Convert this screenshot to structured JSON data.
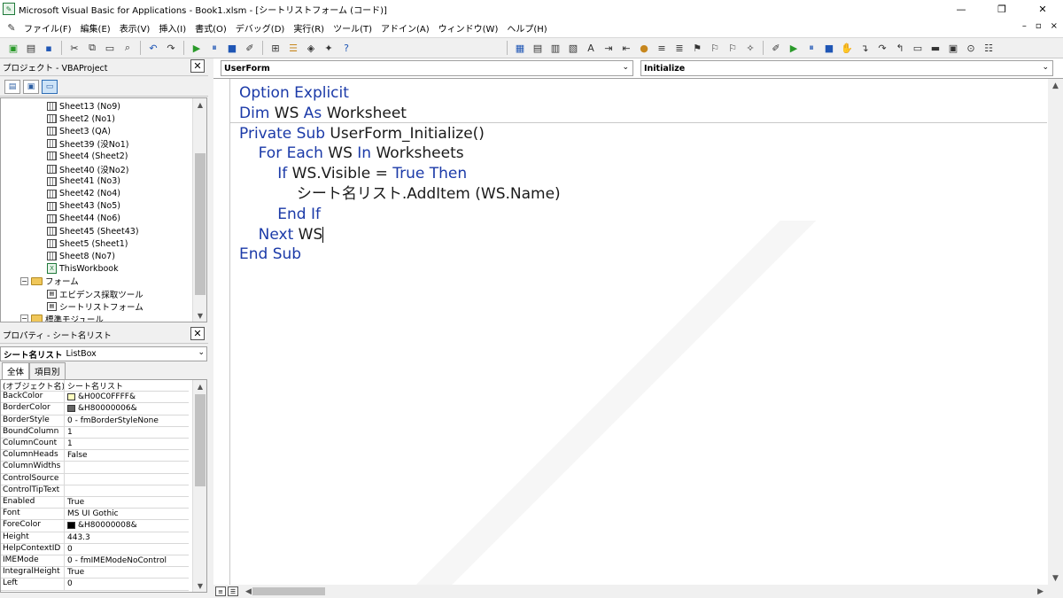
{
  "window": {
    "title": "Microsoft Visual Basic for Applications - Book1.xlsm - [シートリストフォーム (コード)]",
    "controls": {
      "minimize": "—",
      "restore": "❐",
      "close": "✕"
    }
  },
  "menu": {
    "items": [
      "ファイル(F)",
      "編集(E)",
      "表示(V)",
      "挿入(I)",
      "書式(O)",
      "デバッグ(D)",
      "実行(R)",
      "ツール(T)",
      "アドイン(A)",
      "ウィンドウ(W)",
      "ヘルプ(H)"
    ],
    "child_controls": [
      "–",
      "▫",
      "×"
    ]
  },
  "project_pane": {
    "title": "プロジェクト - VBAProject",
    "tree": [
      {
        "label": "Sheet13 (No9)",
        "kind": "sheet"
      },
      {
        "label": "Sheet2 (No1)",
        "kind": "sheet"
      },
      {
        "label": "Sheet3 (QA)",
        "kind": "sheet"
      },
      {
        "label": "Sheet39 (没No1)",
        "kind": "sheet"
      },
      {
        "label": "Sheet4 (Sheet2)",
        "kind": "sheet"
      },
      {
        "label": "Sheet40 (没No2)",
        "kind": "sheet"
      },
      {
        "label": "Sheet41 (No3)",
        "kind": "sheet"
      },
      {
        "label": "Sheet42 (No4)",
        "kind": "sheet"
      },
      {
        "label": "Sheet43 (No5)",
        "kind": "sheet"
      },
      {
        "label": "Sheet44 (No6)",
        "kind": "sheet"
      },
      {
        "label": "Sheet45 (Sheet43)",
        "kind": "sheet"
      },
      {
        "label": "Sheet5 (Sheet1)",
        "kind": "sheet"
      },
      {
        "label": "Sheet8 (No7)",
        "kind": "sheet"
      },
      {
        "label": "ThisWorkbook",
        "kind": "workbook"
      },
      {
        "label": "フォーム",
        "kind": "folder"
      },
      {
        "label": "エビデンス採取ツール",
        "kind": "form"
      },
      {
        "label": "シートリストフォーム",
        "kind": "form"
      },
      {
        "label": "標準モジュール",
        "kind": "folder"
      }
    ]
  },
  "properties_pane": {
    "title": "プロパティ - シート名リスト",
    "object_name": "シート名リスト",
    "object_type": "ListBox",
    "tabs": [
      "全体",
      "項目別"
    ],
    "rows": [
      {
        "name": "(オブジェクト名)",
        "value": "シート名リスト",
        "swatch": ""
      },
      {
        "name": "BackColor",
        "value": "&H00C0FFFF&",
        "swatch": "#ffffc0"
      },
      {
        "name": "BorderColor",
        "value": "&H80000006&",
        "swatch": "#646464"
      },
      {
        "name": "BorderStyle",
        "value": "0 - fmBorderStyleNone",
        "swatch": ""
      },
      {
        "name": "BoundColumn",
        "value": "1",
        "swatch": ""
      },
      {
        "name": "ColumnCount",
        "value": "1",
        "swatch": ""
      },
      {
        "name": "ColumnHeads",
        "value": "False",
        "swatch": ""
      },
      {
        "name": "ColumnWidths",
        "value": "",
        "swatch": ""
      },
      {
        "name": "ControlSource",
        "value": "",
        "swatch": ""
      },
      {
        "name": "ControlTipText",
        "value": "",
        "swatch": ""
      },
      {
        "name": "Enabled",
        "value": "True",
        "swatch": ""
      },
      {
        "name": "Font",
        "value": "MS UI Gothic",
        "swatch": ""
      },
      {
        "name": "ForeColor",
        "value": "&H80000008&",
        "swatch": "#000000"
      },
      {
        "name": "Height",
        "value": "443.3",
        "swatch": ""
      },
      {
        "name": "HelpContextID",
        "value": "0",
        "swatch": ""
      },
      {
        "name": "IMEMode",
        "value": "0 - fmIMEModeNoControl",
        "swatch": ""
      },
      {
        "name": "IntegralHeight",
        "value": "True",
        "swatch": ""
      },
      {
        "name": "Left",
        "value": "0",
        "swatch": ""
      }
    ]
  },
  "code_window": {
    "object_combo": "UserForm",
    "proc_combo": "Initialize",
    "lines": [
      [
        {
          "t": "Option Explicit",
          "k": true
        }
      ],
      [
        {
          "t": "Dim",
          "k": true
        },
        {
          "t": " WS ",
          "k": false
        },
        {
          "t": "As",
          "k": true
        },
        {
          "t": " Worksheet",
          "k": false
        }
      ],
      [
        {
          "t": "Private Sub",
          "k": true
        },
        {
          "t": " UserForm_Initialize()",
          "k": false
        }
      ],
      [
        {
          "t": "    ",
          "k": false
        },
        {
          "t": "For Each",
          "k": true
        },
        {
          "t": " WS ",
          "k": false
        },
        {
          "t": "In",
          "k": true
        },
        {
          "t": " Worksheets",
          "k": false
        }
      ],
      [
        {
          "t": "        ",
          "k": false
        },
        {
          "t": "If",
          "k": true
        },
        {
          "t": " WS.Visible = ",
          "k": false
        },
        {
          "t": "True Then",
          "k": true
        }
      ],
      [
        {
          "t": "            シート名リスト.AddItem (WS.Name)",
          "k": false
        }
      ],
      [
        {
          "t": "        ",
          "k": false
        },
        {
          "t": "End If",
          "k": true
        }
      ],
      [
        {
          "t": "    ",
          "k": false
        },
        {
          "t": "Next",
          "k": true
        },
        {
          "t": " WS",
          "k": false
        }
      ],
      [
        {
          "t": "End Sub",
          "k": true
        }
      ]
    ]
  },
  "colors": {
    "keyword": "#1b3aa8",
    "text": "#1a1a1a"
  }
}
